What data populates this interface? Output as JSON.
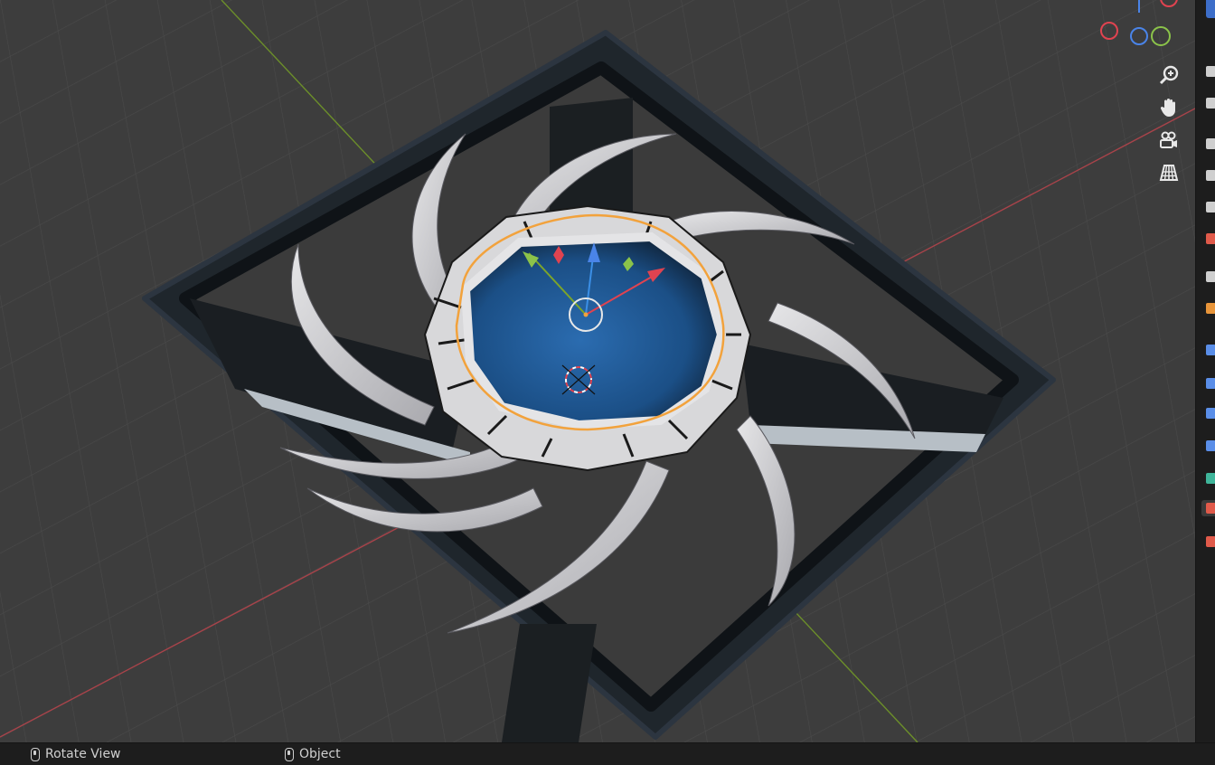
{
  "viewport": {
    "tools": [
      {
        "name": "zoom-icon"
      },
      {
        "name": "pan-hand-icon"
      },
      {
        "name": "camera-view-icon"
      },
      {
        "name": "perspective-grid-icon"
      }
    ],
    "gizmo_axes": [
      {
        "axis": "x",
        "color": "#e04350"
      },
      {
        "axis": "y",
        "color": "#8bc34a"
      },
      {
        "axis": "z",
        "color": "#4a84e8"
      }
    ],
    "colors": {
      "selection_outline": "#f2a23c",
      "x_axis": "#c9404a",
      "y_axis": "#7da52a",
      "z_axis": "#3b8fe6",
      "frame": "#1f262c",
      "blades": "#cfcfd2",
      "hub_glass": "#1f5a9a"
    }
  },
  "properties_tabs": [
    {
      "name": "tool-tab-icon",
      "color": "#cfcfcf"
    },
    {
      "name": "render-tab-icon",
      "color": "#cfcfcf"
    },
    {
      "name": "output-tab-icon",
      "color": "#cfcfcf"
    },
    {
      "name": "view-layer-tab-icon",
      "color": "#cfcfcf"
    },
    {
      "name": "scene-tab-icon",
      "color": "#cfcfcf"
    },
    {
      "name": "world-tab-icon",
      "color": "#e05a4a"
    },
    {
      "name": "collection-tab-icon",
      "color": "#cfcfcf"
    },
    {
      "name": "object-tab-icon",
      "color": "#e8953a"
    },
    {
      "name": "modifier-tab-icon",
      "color": "#5a8ee8"
    },
    {
      "name": "particles-tab-icon",
      "color": "#5a8ee8"
    },
    {
      "name": "physics-tab-icon",
      "color": "#5a8ee8"
    },
    {
      "name": "constraints-tab-icon",
      "color": "#5a8ee8"
    },
    {
      "name": "data-tab-icon",
      "color": "#3fb59a"
    },
    {
      "name": "material-tab-icon",
      "color": "#e05a4a"
    },
    {
      "name": "texture-tab-icon",
      "color": "#e05a4a"
    }
  ],
  "status_bar": {
    "left_action": "Rotate View",
    "middle_action": "Object"
  }
}
